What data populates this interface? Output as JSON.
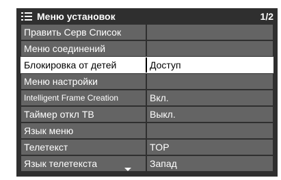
{
  "header": {
    "title": "Меню установок",
    "page_indicator": "1/2"
  },
  "rows": [
    {
      "label": "Править Серв Список",
      "value": ""
    },
    {
      "label": "Меню соединений",
      "value": ""
    },
    {
      "label": "Блокировка от детей",
      "value": "Доступ",
      "selected": true
    },
    {
      "label": "Меню настройки",
      "value": ""
    },
    {
      "label": "Intelligent Frame Creation",
      "value": "Вкл."
    },
    {
      "label": "Таймер откл ТВ",
      "value": "Выкл."
    },
    {
      "label": "Язык меню",
      "value": ""
    },
    {
      "label": "Телетекст",
      "value": "TOP"
    },
    {
      "label": "Язык телетекста",
      "value": "Запад"
    }
  ],
  "colors": {
    "panel_bg": "#2f2f2f",
    "row_bg": "#646464",
    "selected_bg": "#ffffff",
    "text": "#ffffff",
    "selected_text": "#000000"
  },
  "icons": {
    "header_icon": "menu-list-icon",
    "scroll_indicator": "scroll-down-arrow-icon"
  }
}
